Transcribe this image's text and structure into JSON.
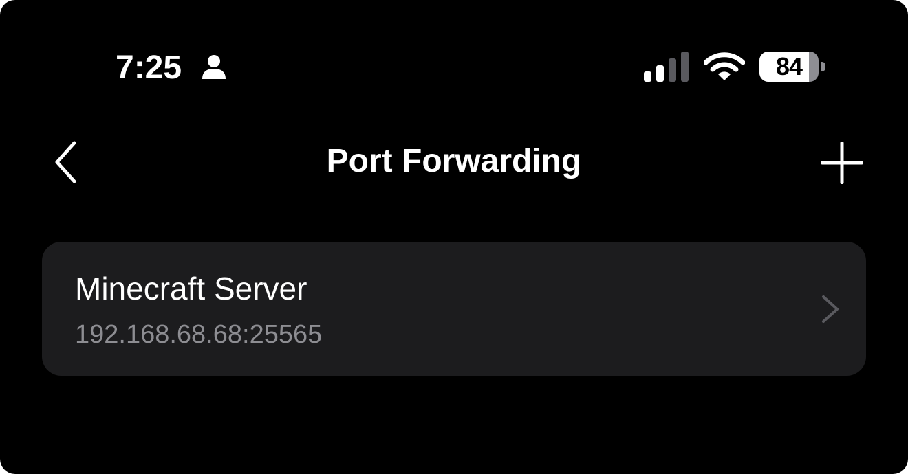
{
  "status_bar": {
    "time": "7:25",
    "battery_level": "84",
    "battery_fraction": 0.84,
    "icons": {
      "person": "person-icon",
      "signal": "signal-icon",
      "wifi": "wifi-icon",
      "battery": "battery-icon"
    }
  },
  "nav": {
    "title": "Port Forwarding",
    "back_icon": "chevron-left-icon",
    "add_icon": "plus-icon"
  },
  "rules": [
    {
      "name": "Minecraft Server",
      "address": "192.168.68.68:25565",
      "icon": "chevron-right-icon"
    }
  ],
  "colors": {
    "background": "#000000",
    "card": "#1c1c1e",
    "primary_text": "#ffffff",
    "secondary_text": "#8d8d92",
    "chevron": "#5a5a5f"
  }
}
